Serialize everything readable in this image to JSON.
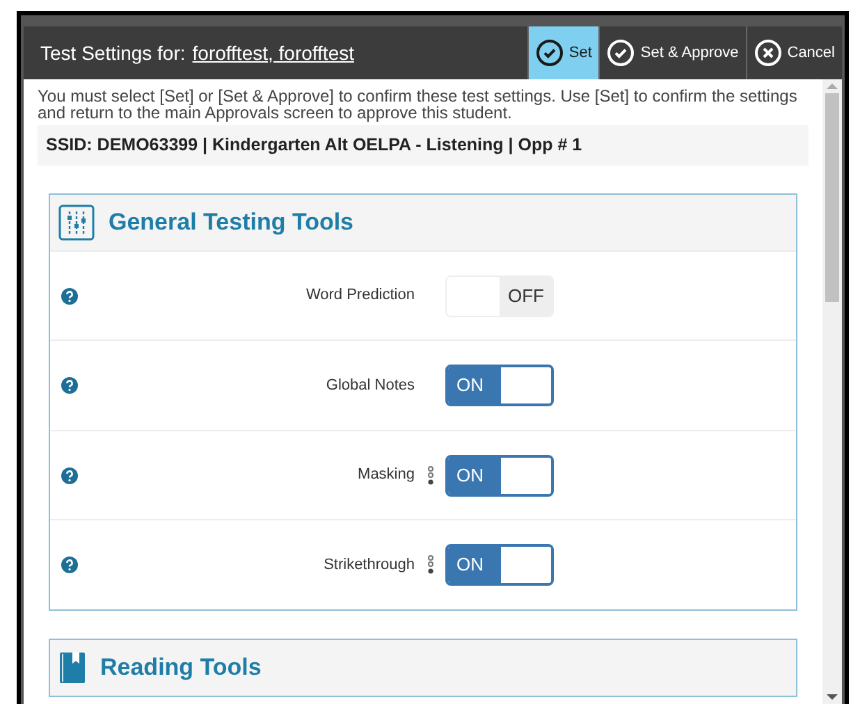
{
  "window": {
    "title": "Test Settings for:",
    "student": "forofftest, forofftest"
  },
  "actions": [
    {
      "label": "Set",
      "kind": "check",
      "selected": true
    },
    {
      "label": "Set & Approve",
      "kind": "check",
      "selected": false
    },
    {
      "label": "Cancel",
      "kind": "cancel",
      "selected": false
    }
  ],
  "instructions": "You must select [Set] or [Set & Approve] to confirm these test settings. Use [Set] to confirm the settings and return to the main Approvals screen to approve this student.",
  "test_info": "SSID: DEMO63399 | Kindergarten Alt OELPA - Listening | Opp # 1",
  "sections": [
    {
      "title": "General Testing Tools",
      "kind": "tools",
      "settings": [
        {
          "label": "Word Prediction",
          "on": false,
          "options": false,
          "text": "OFF"
        },
        {
          "label": "Global Notes",
          "on": true,
          "options": false,
          "text": "ON"
        },
        {
          "label": "Masking",
          "on": true,
          "options": true,
          "text": "ON"
        },
        {
          "label": "Strikethrough",
          "on": true,
          "options": true,
          "text": "ON"
        }
      ]
    },
    {
      "title": "Reading Tools",
      "kind": "book"
    }
  ]
}
